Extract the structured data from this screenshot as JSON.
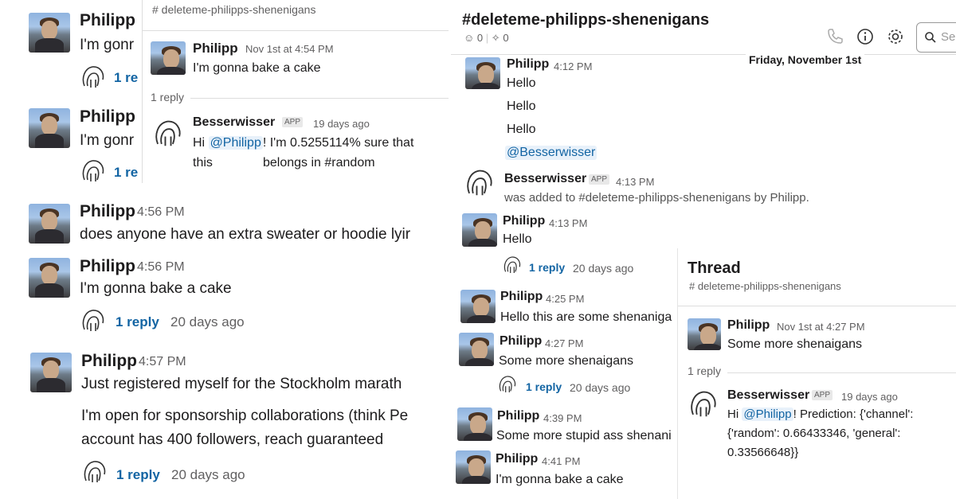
{
  "left": {
    "messages": [
      {
        "name": "Philipp",
        "time": "",
        "text": "I'm gonr",
        "reply": "1 re",
        "ago": ""
      },
      {
        "name": "Philipp",
        "time": "",
        "text": "I'm gonr",
        "reply": "1 re",
        "ago": ""
      },
      {
        "name": "Philipp",
        "time": "4:56 PM",
        "text": "does anyone have an extra sweater or hoodie lyir"
      },
      {
        "name": "Philipp",
        "time": "4:56 PM",
        "text": "I'm gonna bake a cake",
        "reply": "1 reply",
        "ago": "20 days ago"
      },
      {
        "name": "Philipp",
        "time": "4:57 PM",
        "text": "Just registered myself for the Stockholm marath",
        "text2": "I'm open for sponsorship collaborations (think Pe",
        "text3": "account has 400 followers, reach guaranteed",
        "reply": "1 reply",
        "ago": "20 days ago"
      }
    ]
  },
  "thread1": {
    "channel": "# deleteme-philipps-shenenigans",
    "parent": {
      "name": "Philipp",
      "time": "Nov 1st at 4:54 PM",
      "text": "I'm gonna bake a cake"
    },
    "reply_count": "1 reply",
    "bot": {
      "name": "Besserwisser",
      "badge": "APP",
      "time": "19 days ago",
      "pre": "Hi ",
      "mention": "@Philipp",
      "post": "! I'm 0.5255114% sure that",
      "line2a": "this",
      "line2b": "belongs in #random"
    }
  },
  "channel": {
    "title": "#deleteme-philipps-shenenigans",
    "members": "0",
    "pins": "0",
    "search_placeholder": "Se",
    "date_divider": "Friday, November 1st",
    "msgs": {
      "m1": {
        "name": "Philipp",
        "time": "4:12 PM",
        "lines": [
          "Hello",
          "Hello",
          "Hello"
        ],
        "mention": "@Besserwisser"
      },
      "m2": {
        "name": "Besserwisser",
        "badge": "APP",
        "time": "4:13 PM",
        "text": "was added to #deleteme-philipps-shenenigans by Philipp."
      },
      "m3": {
        "name": "Philipp",
        "time": "4:13 PM",
        "text": "Hello",
        "reply": "1 reply",
        "ago": "20 days ago"
      },
      "m4": {
        "name": "Philipp",
        "time": "4:25 PM",
        "text": "Hello this are some shenaniga"
      },
      "m5": {
        "name": "Philipp",
        "time": "4:27 PM",
        "text": "Some more shenaigans",
        "reply": "1 reply",
        "ago": "20 days ago"
      },
      "m6": {
        "name": "Philipp",
        "time": "4:39 PM",
        "text": "Some more stupid ass shenani"
      },
      "m7": {
        "name": "Philipp",
        "time": "4:41 PM",
        "text": "I'm gonna bake a cake"
      }
    }
  },
  "thread2": {
    "title": "Thread",
    "channel": "# deleteme-philipps-shenenigans",
    "parent": {
      "name": "Philipp",
      "time": "Nov 1st at 4:27 PM",
      "text": "Some more shenaigans"
    },
    "reply_count": "1 reply",
    "bot": {
      "name": "Besserwisser",
      "badge": "APP",
      "time": "19 days ago",
      "pre": "Hi ",
      "mention": "@Philipp",
      "post": "! Prediction: {'channel':",
      "line2": "{'random': 0.66433346, 'general':",
      "line3": "0.33566648}}"
    }
  },
  "colors": {
    "link": "#1264a3",
    "muted": "#616061",
    "text": "#1d1c1d"
  }
}
